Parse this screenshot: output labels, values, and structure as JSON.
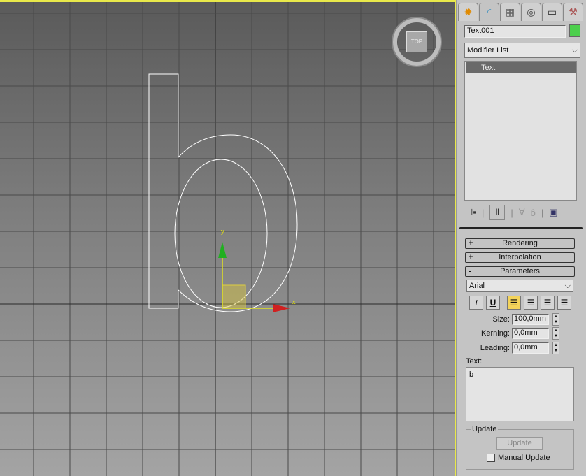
{
  "viewport": {
    "label_y": "y",
    "label_x": "x",
    "viewcube_label": "TOP"
  },
  "panel": {
    "tabs": [
      {
        "icon": "create-icon",
        "glyph": "✹"
      },
      {
        "icon": "modify-icon",
        "glyph": "◜"
      },
      {
        "icon": "hierarchy-icon",
        "glyph": "▦"
      },
      {
        "icon": "motion-icon",
        "glyph": "◎"
      },
      {
        "icon": "display-icon",
        "glyph": "▭"
      },
      {
        "icon": "utilities-icon",
        "glyph": "⚒"
      }
    ],
    "object_name": "Text001",
    "object_color": "#4ccf4c",
    "modifier_list": "Modifier List",
    "stack_items": [
      "Text"
    ],
    "rollouts": {
      "rendering": "Rendering",
      "interpolation": "Interpolation",
      "parameters": "Parameters",
      "plus": "+",
      "minus": "-"
    },
    "font": "Arial",
    "format_buttons": {
      "italic": "I",
      "underline": "U"
    },
    "size_label": "Size:",
    "size_value": "100,0mm",
    "kerning_label": "Kerning:",
    "kerning_value": "0,0mm",
    "leading_label": "Leading:",
    "leading_value": "0,0mm",
    "text_label": "Text:",
    "text_value": "b",
    "update_group": "Update",
    "update_button": "Update",
    "manual_update": "Manual Update",
    "manual_update_checked": false
  }
}
